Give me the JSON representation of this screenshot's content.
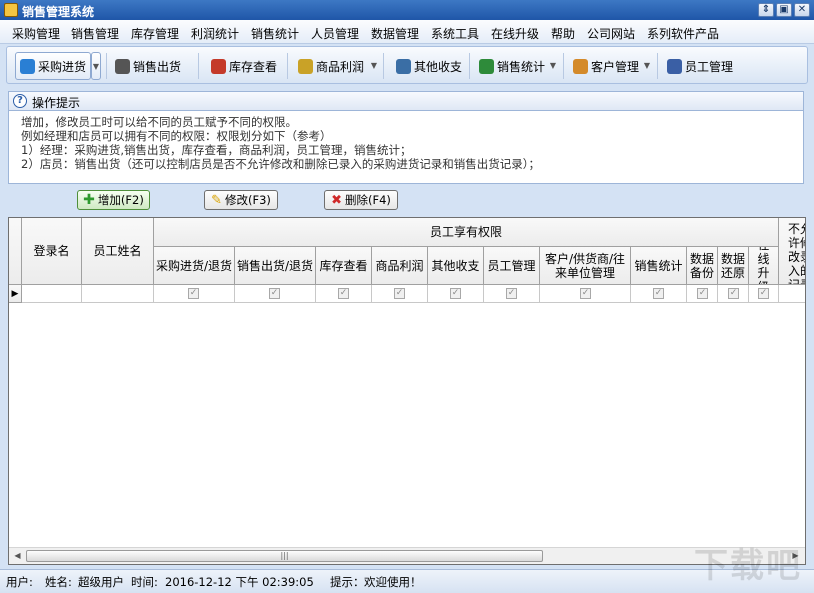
{
  "window": {
    "title": "销售管理系统",
    "minimize_glyph": "⇕",
    "maximize_glyph": "▣",
    "close_glyph": "✕"
  },
  "menu": [
    "采购管理",
    "销售管理",
    "库存管理",
    "利润统计",
    "销售统计",
    "人员管理",
    "数据管理",
    "系统工具",
    "在线升级",
    "帮助",
    "公司网站",
    "系列软件产品"
  ],
  "toolbar": [
    {
      "label": "采购进货",
      "icon": "purchase-icon",
      "color": "#2a7fd4",
      "dropdown": true
    },
    {
      "label": "销售出货",
      "icon": "sales-icon",
      "color": "#555555",
      "dropdown": false
    },
    {
      "label": "库存查看",
      "icon": "inventory-icon",
      "color": "#c43a2a",
      "dropdown": false
    },
    {
      "label": "商品利润",
      "icon": "money-bag-icon",
      "color": "#c9a227",
      "dropdown": true
    },
    {
      "label": "其他收支",
      "icon": "phone-icon",
      "color": "#3a6ea5",
      "dropdown": false
    },
    {
      "label": "销售统计",
      "icon": "chart-icon",
      "color": "#2e8b3a",
      "dropdown": true
    },
    {
      "label": "客户管理",
      "icon": "people-icon",
      "color": "#d48a2a",
      "dropdown": true
    },
    {
      "label": "员工管理",
      "icon": "staff-icon",
      "color": "#3a5fa5",
      "dropdown": false
    }
  ],
  "tips": {
    "title": "操作提示",
    "lines": [
      "增加，修改员工时可以给不同的员工赋予不同的权限。",
      "例如经理和店员可以拥有不同的权限：权限划分如下（参考）",
      "1）经理：采购进货,销售出货，库存查看，商品利润，员工管理，销售统计；",
      "2）店员：销售出货（还可以控制店员是否不允许修改和删除已录入的采购进货记录和销售出货记录）；"
    ]
  },
  "actions": {
    "add": "增加(F2)",
    "edit": "修改(F3)",
    "delete": "删除(F4)"
  },
  "grid": {
    "col_login": "登录名",
    "col_name": "员工姓名",
    "group_header": "员工享有权限",
    "permissions": [
      "采购进货/退货",
      "销售出货/退货",
      "库存查看",
      "商品利润",
      "其他收支",
      "员工管理",
      "客户/供货商/往来单位管理",
      "销售统计",
      "数据备份",
      "数据还原",
      "在线升级"
    ],
    "col_extra": "不允许修改录入的记录",
    "row_indicator": "▶",
    "checked_glyph": "✓",
    "rows": [
      {
        "login": "",
        "name": "",
        "perms": [
          true,
          true,
          true,
          true,
          true,
          true,
          true,
          true,
          true,
          true,
          true
        ]
      }
    ],
    "scroll_left": "◀",
    "scroll_right": "▶",
    "scroll_grip": "|||"
  },
  "status": {
    "user_label": "用户:",
    "name_label": "姓名:",
    "name_value": "超级用户",
    "time_label": "时间:",
    "time_value": "2016-12-12 下午 02:39:05",
    "hint_label": "提示：",
    "hint_value": "欢迎使用！"
  },
  "watermark": "下载吧"
}
